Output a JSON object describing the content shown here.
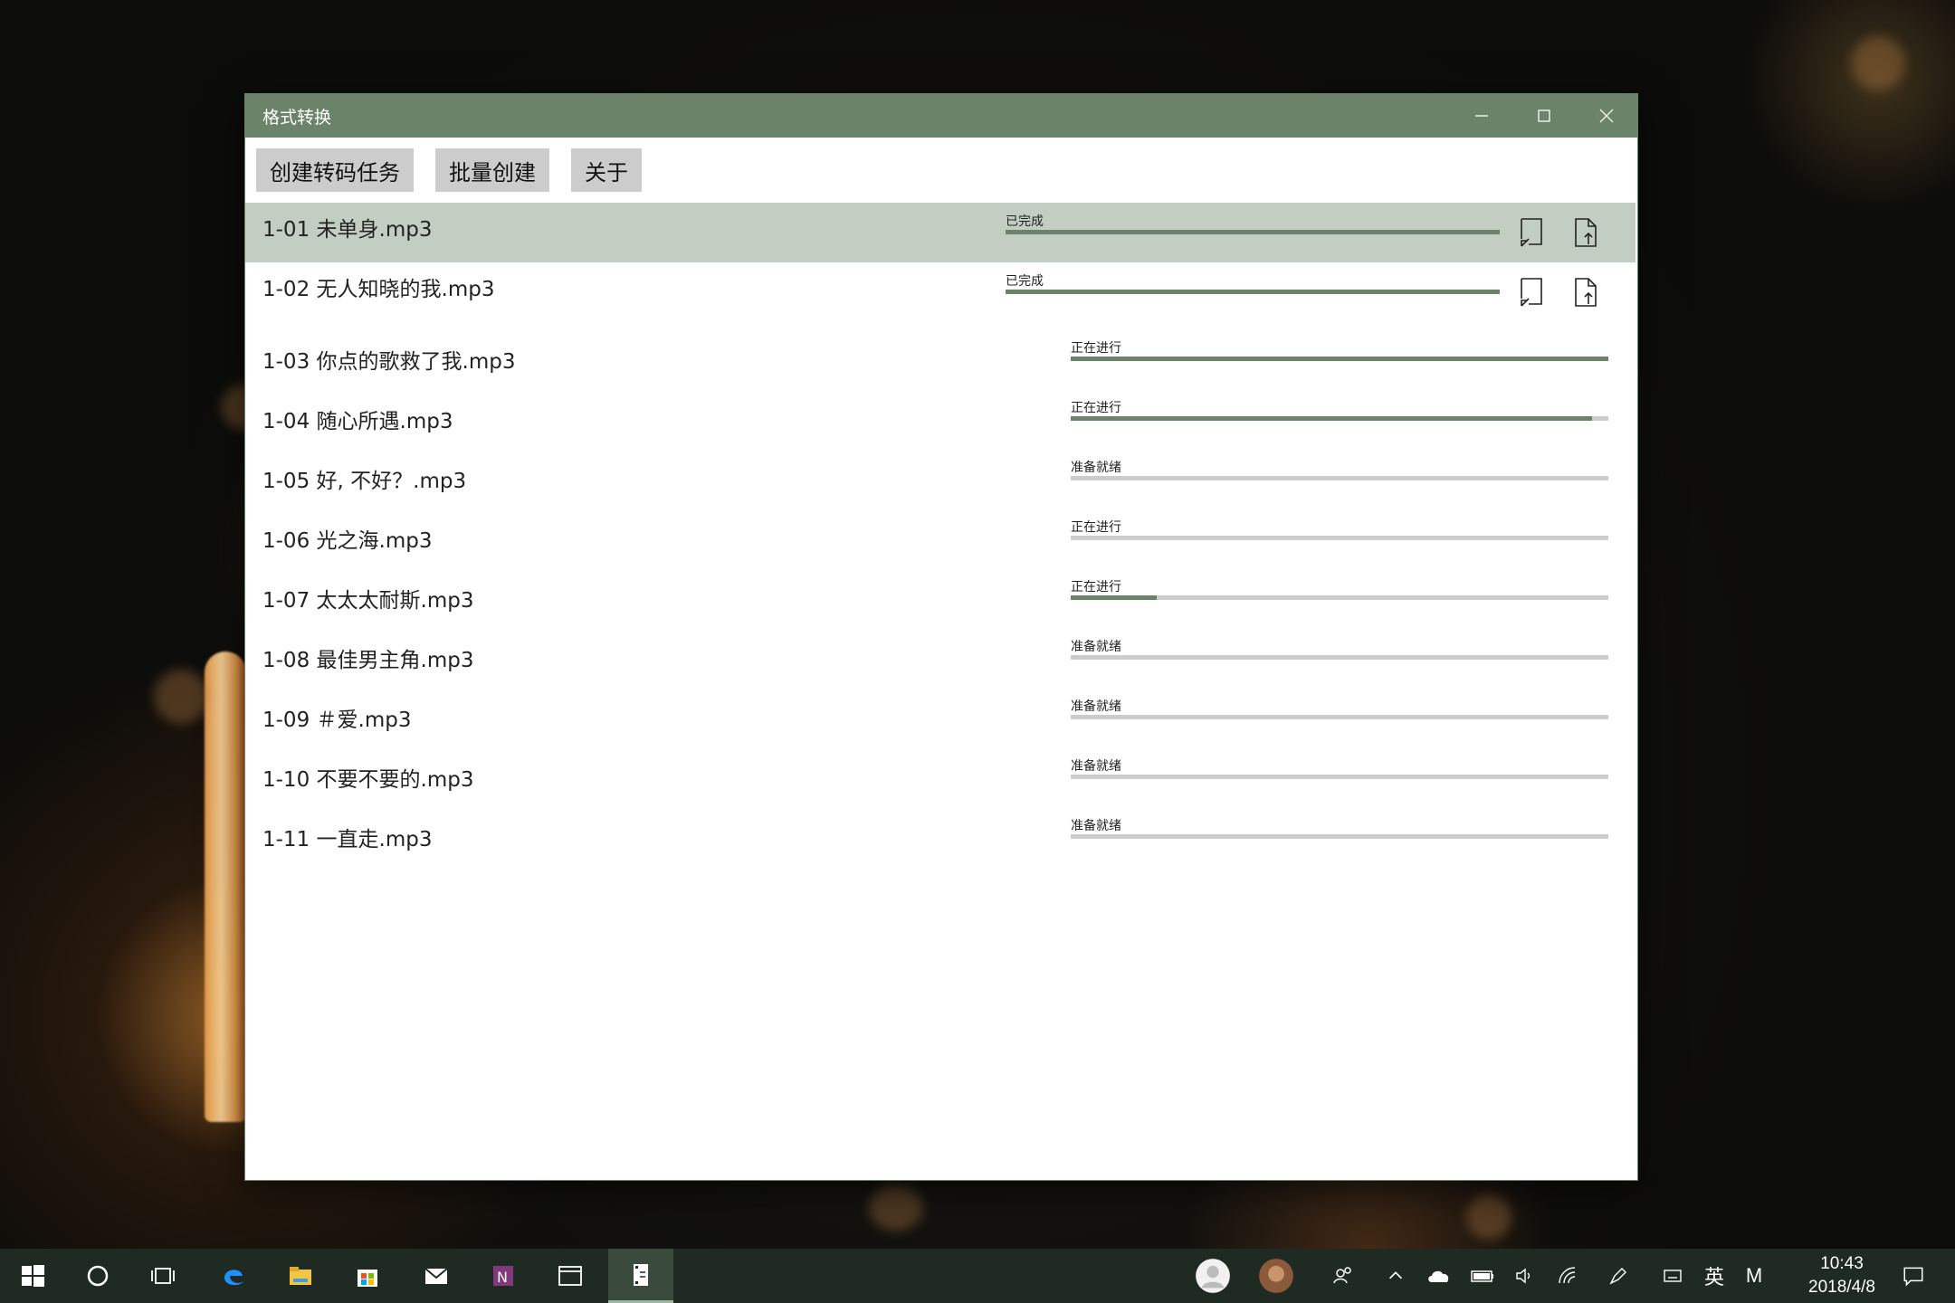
{
  "window": {
    "title": "格式转换"
  },
  "toolbar": {
    "create_task": "创建转码任务",
    "batch_create": "批量创建",
    "about": "关于"
  },
  "files": [
    {
      "name": "1-01 未单身.mp3",
      "status": "已完成",
      "progress": 1.0,
      "done": true,
      "selected": true
    },
    {
      "name": "1-02 无人知晓的我.mp3",
      "status": "已完成",
      "progress": 1.0,
      "done": true,
      "selected": false
    },
    {
      "name": "1-03 你点的歌救了我.mp3",
      "status": "正在进行",
      "progress": 1.0,
      "done": false
    },
    {
      "name": "1-04 随心所遇.mp3",
      "status": "正在进行",
      "progress": 0.97,
      "done": false
    },
    {
      "name": "1-05 好, 不好？.mp3",
      "status": "准备就绪",
      "progress": 0,
      "done": false
    },
    {
      "name": "1-06 光之海.mp3",
      "status": "正在进行",
      "progress": 0,
      "done": false
    },
    {
      "name": "1-07 太太太耐斯.mp3",
      "status": "正在进行",
      "progress": 0.16,
      "done": false
    },
    {
      "name": "1-08 最佳男主角.mp3",
      "status": "准备就绪",
      "progress": 0,
      "done": false
    },
    {
      "name": "1-09 ＃爱.mp3",
      "status": "准备就绪",
      "progress": 0,
      "done": false
    },
    {
      "name": "1-10 不要不要的.mp3",
      "status": "准备就绪",
      "progress": 0,
      "done": false
    },
    {
      "name": "1-11 一直走.mp3",
      "status": "准备就绪",
      "progress": 0,
      "done": false
    }
  ],
  "taskbar": {
    "icons": [
      "windows-start-icon",
      "cortana-icon",
      "task-view-icon",
      "edge-icon",
      "file-explorer-icon",
      "store-icon",
      "mail-icon",
      "onenote-icon",
      "window-app-icon",
      "format-convert-app-icon"
    ],
    "tray": {
      "ime_lang": "英",
      "ime_mode": "M",
      "time": "10:43",
      "date": "2018/4/8"
    }
  },
  "colors": {
    "accent": "#6b8368",
    "selected_row": "#c3cec2",
    "track": "#cccccc",
    "button": "#cccccc"
  }
}
